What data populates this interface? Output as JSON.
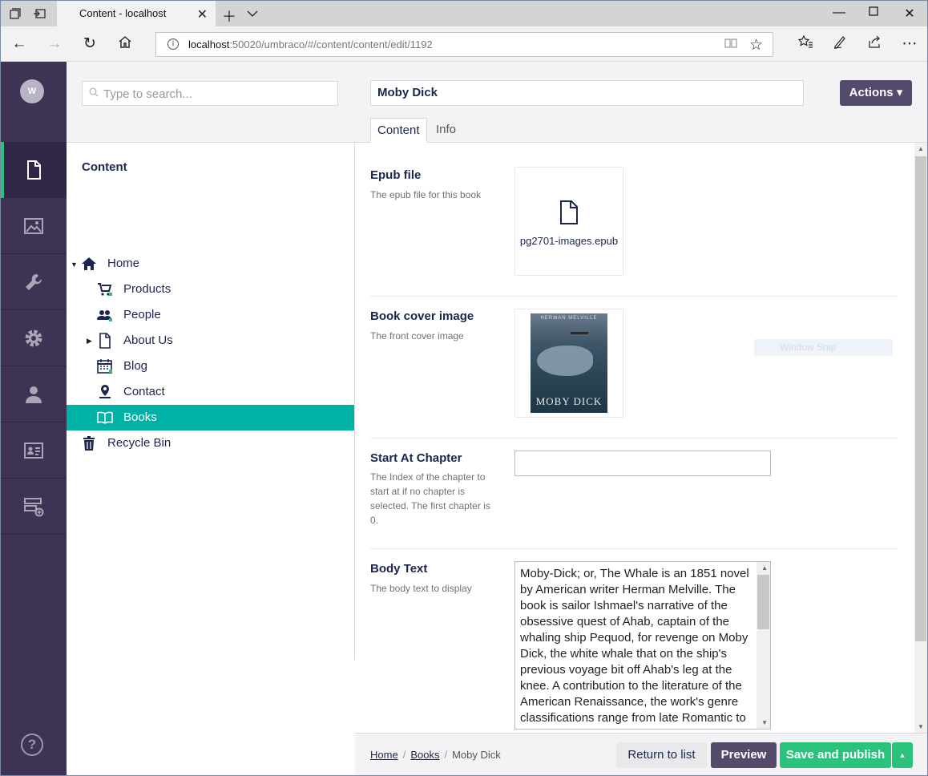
{
  "browser": {
    "tab_title": "Content - localhost",
    "url_host": "localhost",
    "url_rest": ":50020/umbraco/#/content/content/edit/1192"
  },
  "sidebar": {
    "avatar_initial": "W",
    "help_label": "?"
  },
  "tree": {
    "search_placeholder": "Type to search...",
    "title": "Content",
    "nodes": [
      {
        "label": "Home",
        "icon": "home-icon"
      },
      {
        "label": "Products",
        "icon": "shopping-cart-icon"
      },
      {
        "label": "People",
        "icon": "users-icon"
      },
      {
        "label": "About Us",
        "icon": "document-icon"
      },
      {
        "label": "Blog",
        "icon": "calendar-icon"
      },
      {
        "label": "Contact",
        "icon": "map-pin-icon"
      },
      {
        "label": "Books",
        "icon": "book-icon"
      },
      {
        "label": "Recycle Bin",
        "icon": "trash-icon"
      }
    ]
  },
  "editor": {
    "name": "Moby Dick",
    "actions_label": "Actions ▾",
    "tabs": [
      {
        "label": "Content"
      },
      {
        "label": "Info"
      }
    ],
    "properties": [
      {
        "label": "Epub file",
        "description": "The epub file for this book",
        "filename": "pg2701-images.epub"
      },
      {
        "label": "Book cover image",
        "description": "The front cover image",
        "cover_author": "HERMAN MELVILLE",
        "cover_title": "MOBY DICK"
      },
      {
        "label": "Start At Chapter",
        "description": "The Index of the chapter to start at if no chapter is selected. The first chapter is 0.",
        "value": ""
      },
      {
        "label": "Body Text",
        "description": "The body text to display",
        "value": "Moby-Dick; or, The Whale is an 1851 novel by American writer Herman Melville. The book is sailor Ishmael's narrative of the obsessive quest of Ahab, captain of the whaling ship Pequod, for revenge on Moby Dick, the white whale that on the ship's previous voyage bit off Ahab's leg at the knee. A contribution to the literature of the American Renaissance, the work's genre classifications range from late Romantic to"
      }
    ],
    "snip_overlay": "Window Snip"
  },
  "footer": {
    "breadcrumbs": [
      {
        "label": "Home"
      },
      {
        "label": "Books"
      },
      {
        "label": "Moby Dick"
      }
    ],
    "return_label": "Return to list",
    "preview_label": "Preview",
    "publish_label": "Save and publish"
  },
  "colors": {
    "sidebar": "#3e3355",
    "selected": "#00b1a5",
    "publish": "#2bc37c",
    "primary": "#544a6c"
  }
}
